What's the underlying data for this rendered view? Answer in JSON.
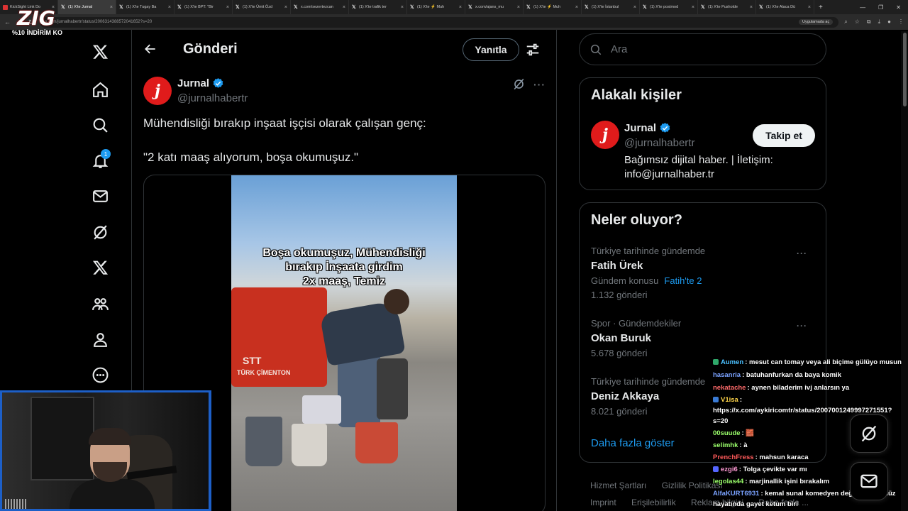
{
  "browser": {
    "tabs": [
      {
        "label": "KickSight Link Do",
        "icon": "kick-icon"
      },
      {
        "label": "(1) X'te Jurnal",
        "icon": "x-icon",
        "active": true
      },
      {
        "label": "(1) X'te Tugay Ba",
        "icon": "x-icon"
      },
      {
        "label": "(1) X'te BPT: \"Bir",
        "icon": "x-icon"
      },
      {
        "label": "(1) X'te Ümit Özd",
        "icon": "x-icon"
      },
      {
        "label": "x.com/sezertezcan",
        "icon": "x-icon"
      },
      {
        "label": "(1) X'te trafik ter",
        "icon": "x-icon"
      },
      {
        "label": "(1) X'te ⚡ Muh",
        "icon": "x-icon"
      },
      {
        "label": "x.com/ajans_mu",
        "icon": "x-icon"
      },
      {
        "label": "(1) X'te ⚡ Muh",
        "icon": "x-icon"
      },
      {
        "label": "(1) X'te İstanbul",
        "icon": "x-icon"
      },
      {
        "label": "(1) X'te postmod",
        "icon": "x-icon"
      },
      {
        "label": "(1) X'te Pusholde",
        "icon": "x-icon"
      },
      {
        "label": "(1) X'te Alaca Dü",
        "icon": "x-icon"
      }
    ],
    "url": "x.com/jurnalhabertr/status/2006314388572041652?s=20",
    "open_in_app": "Uygulamada aç"
  },
  "overlay": {
    "logo_text": "ZIG",
    "promo_text": "%10 İNDİRİM KO"
  },
  "nav": {
    "items": [
      {
        "name": "x-logo-icon"
      },
      {
        "name": "home-icon"
      },
      {
        "name": "explore-icon"
      },
      {
        "name": "notifications-icon",
        "badge": "1"
      },
      {
        "name": "messages-icon"
      },
      {
        "name": "grok-icon"
      },
      {
        "name": "premium-x-icon"
      },
      {
        "name": "communities-icon"
      },
      {
        "name": "profile-icon"
      },
      {
        "name": "more-icon"
      }
    ]
  },
  "header": {
    "title": "Gönderi",
    "reply_label": "Yanıtla"
  },
  "post": {
    "author_name": "Jurnal",
    "author_handle": "@jurnalhabertr",
    "avatar_letter": "j",
    "text_line1": "Mühendisliği bırakıp inşaat işçisi olarak çalışan genç:",
    "text_line2": "\"2 katı maaş alıyorum, boşa okumuşuz.\"",
    "video_caption_1": "Boşa okumuşuz, Mühendisliği",
    "video_caption_2": "bırakıp İnşaata girdim",
    "video_caption_3": "2x maaş, Temiz",
    "video_bag_brand": "STT",
    "video_bag_text": "TÜRK ÇİMENTON"
  },
  "search": {
    "placeholder": "Ara"
  },
  "related": {
    "title": "Alakalı kişiler",
    "name": "Jurnal",
    "handle": "@jurnalhabertr",
    "follow_label": "Takip et",
    "bio": "Bağımsız dijital haber. | İletişim: info@jurnalhaber.tr"
  },
  "trends": {
    "title": "Neler oluyor?",
    "items": [
      {
        "context": "Türkiye tarihinde gündemde",
        "name": "Fatih Ürek",
        "sub": "Gündem konusu",
        "link": "Fatih'te 2",
        "count": "1.132 gönderi"
      },
      {
        "context": "Spor · Gündemdekiler",
        "name": "Okan Buruk",
        "count": "5.678 gönderi"
      },
      {
        "context": "Türkiye tarihinde gündemde",
        "name": "Deniz Akkaya",
        "count": "8.021 gönderi"
      }
    ],
    "show_more": "Daha fazla göster"
  },
  "footer": {
    "links": [
      "Hizmet Şartları",
      "Gizlilik Politikası",
      "Imprint",
      "Erişilebilirlik",
      "Reklam bilgisi",
      "Daha fazla ..."
    ]
  },
  "chat": {
    "messages": [
      {
        "user": "Aumen",
        "color": "#4bc0ff",
        "text": "mesut can tomay veya ali biçime gülüyo musun",
        "badge": "#2fa86a"
      },
      {
        "user": "hasanria",
        "color": "#7aa2ff",
        "text": "batuhanfurkan da baya komik"
      },
      {
        "user": "nekatache",
        "color": "#ff6b6b",
        "text": "aynen biladerim ivj anlarsın ya"
      },
      {
        "user": "V1isa",
        "color": "#ffd54a",
        "text": "",
        "badge": "#3a7bd5"
      },
      {
        "user": "",
        "color": "#ffffff",
        "text": "https://x.com/aykiricomtr/status/2007001249997271551?"
      },
      {
        "user": "",
        "color": "#ffffff",
        "text": "s=20"
      },
      {
        "user": "00suude",
        "color": "#9bff6b",
        "text": "🧱"
      },
      {
        "user": "selimhk",
        "color": "#9bff6b",
        "text": "à"
      },
      {
        "user": "PrenchFress",
        "color": "#ff5a5a",
        "text": "mahsun karaca"
      },
      {
        "user": "ezgi6",
        "color": "#ff9ad5",
        "text": "Tolga çevikte var mı",
        "badge": "#5566ff"
      },
      {
        "user": "legolas44",
        "color": "#9bff6b",
        "text": "marjinallik işini bırakalım"
      },
      {
        "user": "AlfaKURT6931",
        "color": "#7aa2ff",
        "text": "kemal sunal komedyen değil oyuncu düz"
      },
      {
        "user": "",
        "color": "#ffffff",
        "text": "hayatında gayet ketum biri"
      }
    ]
  },
  "fab": {
    "top_icon": "grok-icon",
    "bottom_icon": "messages-icon"
  }
}
